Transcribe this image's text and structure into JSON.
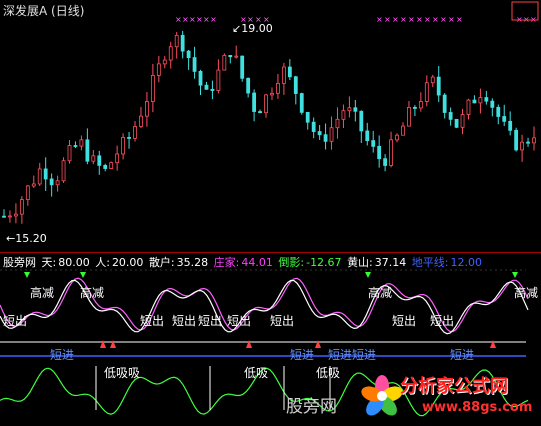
{
  "chart_title": "深发展A (日线)",
  "price_labels": {
    "high": "19.00",
    "low": "15.20"
  },
  "indicator": {
    "name": "股旁网",
    "items": [
      {
        "label": "天:",
        "value": "80.00",
        "color": "#ffffff"
      },
      {
        "label": "人:",
        "value": "20.00",
        "color": "#ffffff"
      },
      {
        "label": "散户:",
        "value": "35.28",
        "color": "#ffffff"
      },
      {
        "label": "庄家:",
        "value": "44.01",
        "color": "#ff40ff"
      },
      {
        "label": "倒影:",
        "value": "-12.67",
        "color": "#40ff40"
      },
      {
        "label": "黄山:",
        "value": "37.14",
        "color": "#ffffff"
      },
      {
        "label": "地平线:",
        "value": "12.00",
        "color": "#4060ff"
      }
    ]
  },
  "signals": {
    "short_out": "短出",
    "high_reduce": "高减",
    "short_in": "短进",
    "short_in_double": "短进短进",
    "low_buy": "低吸",
    "low_buy_alt": "低吸吸"
  },
  "watermark": {
    "text": "股旁网",
    "site": "分析家公式网",
    "url": "www.88gs.com"
  }
}
